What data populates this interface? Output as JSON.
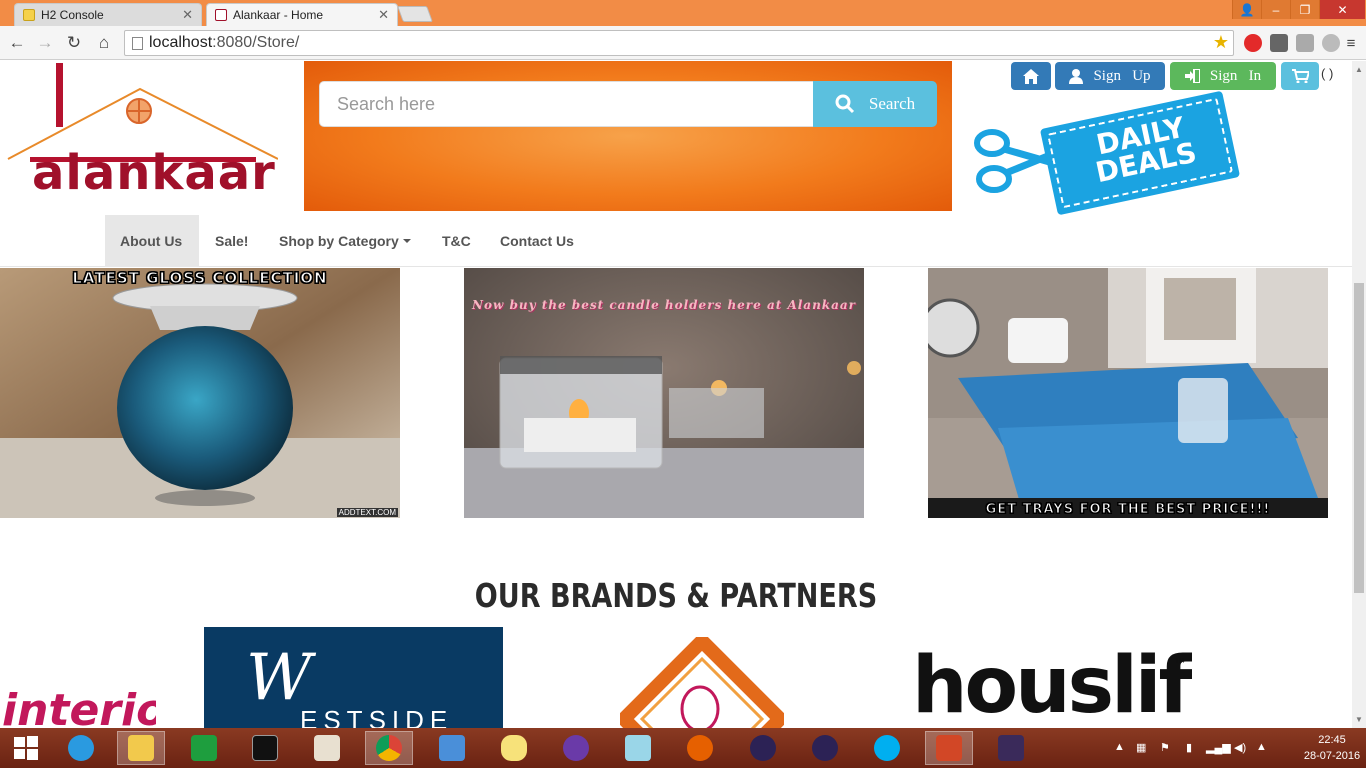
{
  "browser": {
    "tabs": [
      {
        "label": "H2 Console",
        "active": false
      },
      {
        "label": "Alankaar - Home",
        "active": true
      }
    ],
    "url_host": "localhost",
    "url_rest": ":8080/Store/",
    "window_controls": {
      "user": "👤",
      "minimize": "–",
      "restore": "❐",
      "close": "✕"
    }
  },
  "site": {
    "logo_text": "alankaar",
    "search": {
      "placeholder": "Search here",
      "button_label": "Search"
    },
    "top_buttons": {
      "home_icon": "home-icon",
      "signup_label": "Sign   Up",
      "signin_label": "Sign   In",
      "cart_count": "( )"
    },
    "deals": {
      "line1": "DAILY",
      "line2": "DEALS"
    },
    "nav": [
      {
        "label": "About Us",
        "active": true
      },
      {
        "label": "Sale!",
        "active": false
      },
      {
        "label": "Shop by Category",
        "active": false,
        "dropdown": true
      },
      {
        "label": "T&C",
        "active": false
      },
      {
        "label": "Contact Us",
        "active": false
      }
    ],
    "promos": [
      {
        "caption": "LATEST GLOSS COLLECTION",
        "watermark": "ADDTEXT.COM"
      },
      {
        "caption": "Now buy the best candle holders here at Alankaar"
      },
      {
        "caption": "GET TRAYS FOR THE BEST PRICE!!!"
      }
    ],
    "brands_title": "OUR BRANDS & PARTNERS",
    "brands": [
      {
        "text": "interio"
      },
      {
        "text": "ESTSIDE",
        "initial": "W"
      },
      {
        "text": ""
      },
      {
        "text": "houslife",
        "tm": "™"
      }
    ]
  },
  "taskbar": {
    "time": "22:45",
    "date": "28-07-2016",
    "apps": [
      "start",
      "ie",
      "explorer",
      "store",
      "cmd",
      "book",
      "chrome",
      "rdp",
      "db",
      "cat",
      "notepad",
      "firefox",
      "eclipse",
      "eclipse2",
      "skype",
      "powerpoint",
      "javaee"
    ]
  }
}
